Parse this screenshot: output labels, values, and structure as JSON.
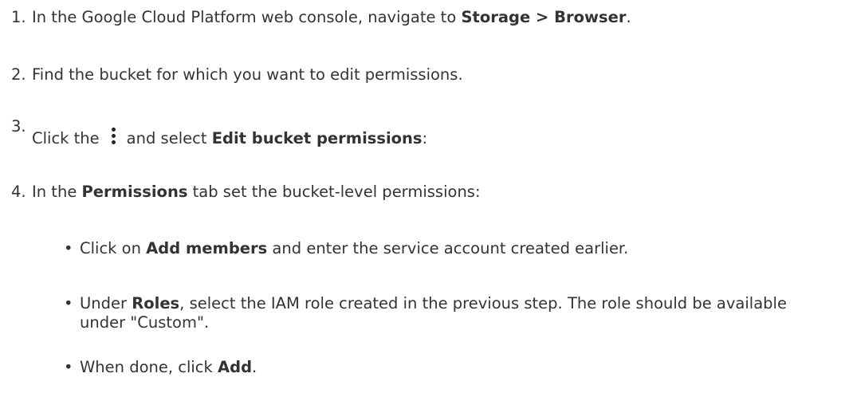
{
  "steps": [
    {
      "num": "1.",
      "pre": "In the Google Cloud Platform web console, navigate to ",
      "bold": "Storage > Browser",
      "post": "."
    },
    {
      "num": "2.",
      "text": "Find the bucket for which you want to edit permissions."
    },
    {
      "num": "3.",
      "pre": "Click the",
      "icon": "more-vert-icon",
      "mid": "and select ",
      "bold": "Edit bucket permissions",
      "post": ":"
    },
    {
      "num": "4.",
      "pre": "In the ",
      "bold": "Permissions",
      "post": " tab set the bucket-level permissions:"
    }
  ],
  "bullets": [
    {
      "pre": "Click on ",
      "bold": "Add members",
      "post": " and enter the service account created earlier."
    },
    {
      "pre": "Under ",
      "bold": "Roles",
      "post": ", select the IAM role created in the previous step. The role should be available under \"Custom\"."
    },
    {
      "pre": "When done, click ",
      "bold": "Add",
      "post": "."
    }
  ],
  "bullet_glyph": "•"
}
